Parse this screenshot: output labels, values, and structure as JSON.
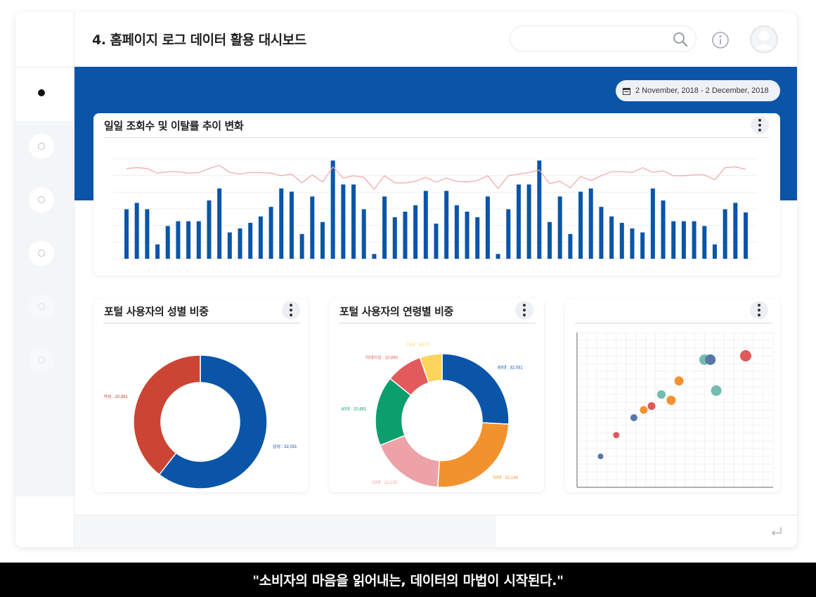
{
  "header": {
    "title": "4. 홈페이지 로그 데이터 활용 대시보드",
    "search_value": "",
    "icons": [
      "search-icon",
      "info-icon",
      "avatar-icon"
    ]
  },
  "sidebar": {
    "items": [
      {
        "state": "active"
      },
      {
        "state": "inactive"
      },
      {
        "state": "inactive"
      },
      {
        "state": "inactive"
      },
      {
        "state": "faint"
      },
      {
        "state": "faint"
      }
    ]
  },
  "date_range": "2 November, 2018 - 2 December, 2018",
  "colors": {
    "brand_blue": "#0a55a8",
    "red": "#cc4433",
    "orange": "#f2922e",
    "pink": "#eca2a6",
    "green": "#0d9e6e",
    "coral": "#e35a5c",
    "yellow": "#fcd45b",
    "line_pink": "#f0a5a5"
  },
  "cards": {
    "trend": {
      "title": "일일 조회수 및 이탈률 추이 변화"
    },
    "gender": {
      "title": "포털 사용자의 성별 비중"
    },
    "age": {
      "title": "포털 사용자의 연령별 비중"
    },
    "scatter": {
      "title": ""
    }
  },
  "chart_data": [
    {
      "type": "bar",
      "title": "일일 조회수 및 이탈률 추이 변화",
      "series": [
        {
          "kind": "bar",
          "values": [
            62,
            70,
            62,
            18,
            41,
            47,
            47,
            47,
            73,
            88,
            33,
            38,
            45,
            53,
            65,
            88,
            84,
            31,
            78,
            46,
            123,
            93,
            93,
            62,
            6,
            78,
            52,
            59,
            67,
            85,
            44,
            85,
            67,
            59,
            52,
            78,
            6,
            62,
            93,
            93,
            123,
            46,
            78,
            31,
            84,
            88,
            65,
            53,
            45,
            38,
            33,
            88,
            73,
            47,
            47,
            47,
            41,
            18,
            62,
            70,
            58
          ]
        },
        {
          "kind": "line",
          "values": [
            113,
            114,
            113,
            107,
            109,
            109,
            107,
            108,
            113,
            117,
            108,
            106,
            108,
            108,
            107,
            104,
            106,
            95,
            105,
            96,
            115,
            101,
            104,
            102,
            87,
            104,
            95,
            95,
            97,
            102,
            96,
            101,
            97,
            96,
            98,
            104,
            88,
            104,
            106,
            108,
            111,
            94,
            97,
            89,
            103,
            98,
            104,
            109,
            109,
            108,
            114,
            108,
            110,
            104,
            104,
            105,
            105,
            99,
            114,
            115,
            112
          ]
        }
      ],
      "grid": true
    },
    {
      "type": "pie",
      "title": "포털 사용자의 성별 비중",
      "categories": [
        "남성 : 32,031",
        "여성 : 20,881"
      ],
      "values": [
        32031,
        20881
      ],
      "donut": true
    },
    {
      "type": "pie",
      "title": "포털 사용자의 연령별 비중",
      "categories": [
        "60대 : 32,031",
        "50대 : 31,146",
        "30대 : 22,135",
        "40대 : 20,881",
        "70대이상 : 10,890",
        "20대 : 6,673"
      ],
      "values": [
        32031,
        31146,
        22135,
        20881,
        10890,
        6673
      ],
      "donut": true
    },
    {
      "type": "scatter",
      "title": "",
      "x": [
        1.2,
        2.0,
        2.9,
        3.4,
        3.8,
        4.3,
        4.8,
        5.2,
        6.5,
        6.8,
        7.1,
        8.6
      ],
      "y": [
        1.6,
        2.7,
        3.6,
        4.0,
        4.2,
        4.8,
        4.5,
        5.5,
        6.6,
        6.6,
        5.0,
        6.8
      ],
      "sizes": [
        6,
        7,
        8,
        9,
        9,
        10,
        11,
        11,
        13,
        13,
        13,
        14
      ],
      "colors": [
        "#5677a8",
        "#dd5a5a",
        "#5677a8",
        "#f2922e",
        "#dd5a5a",
        "#74bcae",
        "#f2922e",
        "#f2922e",
        "#74bcae",
        "#5677a8",
        "#74bcae",
        "#dd5a5a"
      ],
      "grid": true
    }
  ],
  "caption": "\"소비자의 마음을 읽어내는, 데이터의 마법이 시작된다.\""
}
